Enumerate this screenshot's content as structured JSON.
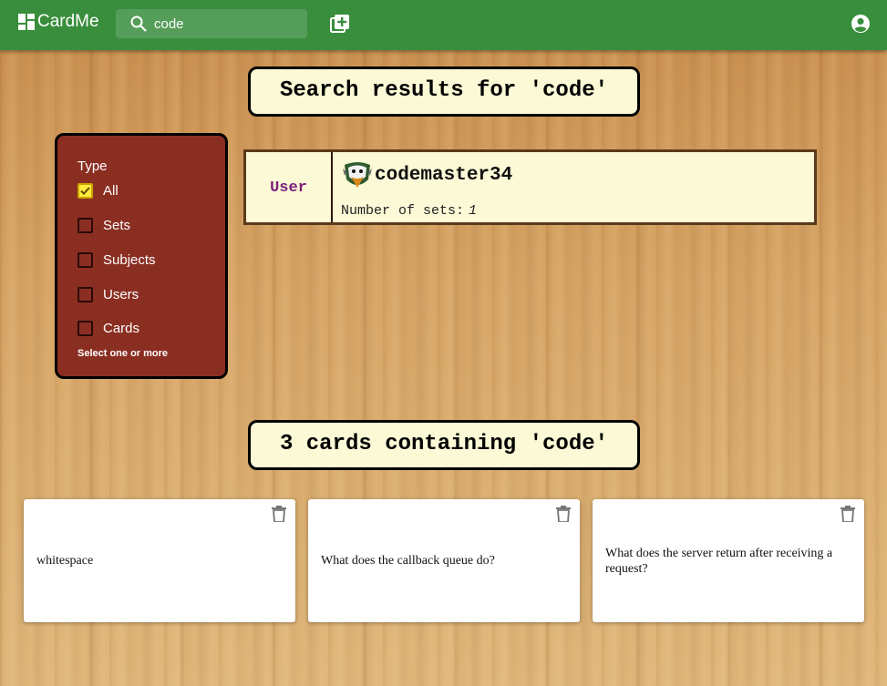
{
  "app": {
    "name": "CardMe"
  },
  "search": {
    "value": "code"
  },
  "headings": {
    "results": "Search results for 'code'",
    "cards": "3 cards containing 'code'"
  },
  "filter": {
    "title": "Type",
    "options": [
      {
        "label": "All",
        "checked": true
      },
      {
        "label": "Sets",
        "checked": false
      },
      {
        "label": "Subjects",
        "checked": false
      },
      {
        "label": "Users",
        "checked": false
      },
      {
        "label": "Cards",
        "checked": false
      }
    ],
    "help": "Select one or more"
  },
  "result": {
    "type": "User",
    "name": "codemaster34",
    "sets_label": "Number of sets:",
    "sets_value": "1"
  },
  "cards": [
    {
      "text": "whitespace"
    },
    {
      "text": "What does the callback queue do?"
    },
    {
      "text": "What does the server return after receiving a request?"
    }
  ],
  "colors": {
    "topbar": "#388e3c",
    "filter_panel": "#8b2e22",
    "heading_bg": "#fbf9d6",
    "result_type": "#7b1f7b",
    "checkbox_checked": "#ffeb3b"
  },
  "icons": [
    "dashboard-icon",
    "search-icon",
    "add-box-icon",
    "account-circle-icon",
    "trash-icon",
    "checkbox-icon"
  ]
}
